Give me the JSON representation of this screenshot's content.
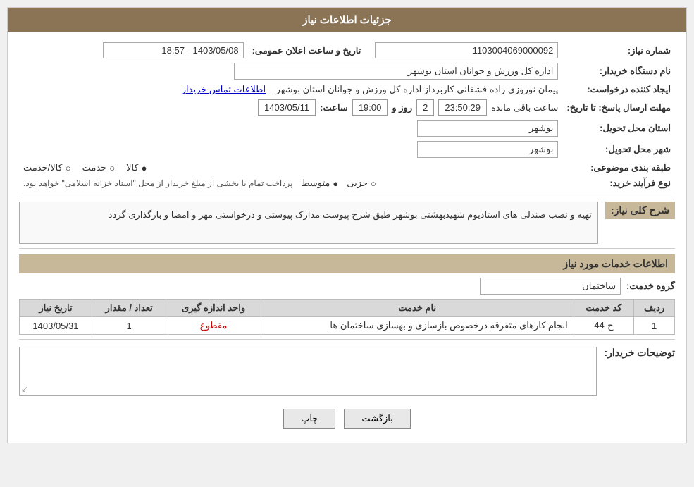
{
  "page": {
    "title": "جزئیات اطلاعات نیاز",
    "header_bg": "#8B7355"
  },
  "fields": {
    "order_number_label": "شماره نیاز:",
    "order_number_value": "1103004069000092",
    "buyer_name_label": "نام دستگاه خریدار:",
    "buyer_name_value": "اداره کل ورزش و جوانان استان بوشهر",
    "creator_label": "ایجاد کننده درخواست:",
    "creator_value": "پیمان نوروزی زاده فشقانی کاربرداز اداره کل ورزش و جوانان استان بوشهر",
    "creator_link": "اطلاعات تماس خریدار",
    "deadline_label": "مهلت ارسال پاسخ: تا تاریخ:",
    "deadline_date": "1403/05/11",
    "deadline_time_label": "ساعت:",
    "deadline_time_value": "19:00",
    "deadline_day_label": "روز و",
    "deadline_day_value": "2",
    "deadline_remaining_label": "ساعت باقی مانده",
    "deadline_remaining_value": "23:50:29",
    "announce_label": "تاریخ و ساعت اعلان عمومی:",
    "announce_value": "1403/05/08 - 18:57",
    "province_label": "استان محل تحویل:",
    "province_value": "بوشهر",
    "city_label": "شهر محل تحویل:",
    "city_value": "بوشهر",
    "category_label": "طبقه بندی موضوعی:",
    "category_options": [
      "کالا",
      "خدمت",
      "کالا/خدمت"
    ],
    "category_selected": "کالا",
    "process_label": "نوع فرآیند خرید:",
    "process_options": [
      "جزیی",
      "متوسط"
    ],
    "process_selected": "متوسط",
    "process_note": "پرداخت تمام یا بخشی از مبلغ خریدار از محل \"اسناد خزانه اسلامی\" خواهد بود.",
    "desc_section_label": "شرح کلی نیاز:",
    "desc_value": "تهیه و نصب صندلی های استادیوم شهیدبهشتی بوشهر طبق شرح پیوست\nمدارک پیوستی و درخواستی مهر و امضا و بارگذاری گردد",
    "services_section_label": "اطلاعات خدمات مورد نیاز",
    "service_group_label": "گروه خدمت:",
    "service_group_value": "ساختمان",
    "table": {
      "headers": [
        "ردیف",
        "کد خدمت",
        "نام خدمت",
        "واحد اندازه گیری",
        "تعداد / مقدار",
        "تاریخ نیاز"
      ],
      "rows": [
        {
          "row": "1",
          "code": "ج-44",
          "name": "انجام کارهای متفرقه درخصوص بازسازی و بهسازی ساختمان ها",
          "unit": "مقطوع",
          "qty": "1",
          "date": "1403/05/31"
        }
      ]
    },
    "buyer_desc_label": "توضیحات خریدار:",
    "buyer_desc_value": "",
    "buttons": {
      "print": "چاپ",
      "back": "بازگشت"
    }
  }
}
